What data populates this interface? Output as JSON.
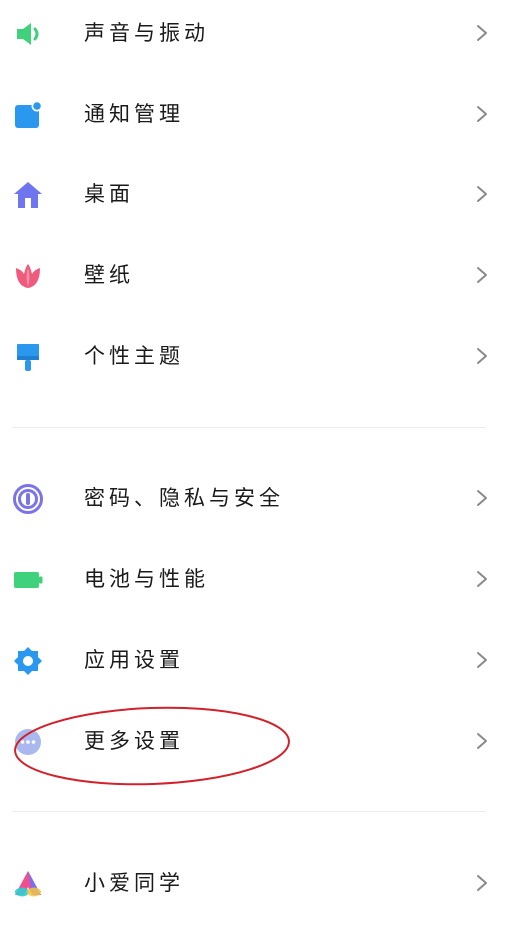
{
  "settings": {
    "group1": [
      {
        "label": "声音与振动",
        "icon": "speaker-icon"
      },
      {
        "label": "通知管理",
        "icon": "notification-icon"
      },
      {
        "label": "桌面",
        "icon": "home-icon"
      },
      {
        "label": "壁纸",
        "icon": "tulip-icon"
      },
      {
        "label": "个性主题",
        "icon": "paint-brush-icon"
      }
    ],
    "group2": [
      {
        "label": "密码、隐私与安全",
        "icon": "fingerprint-icon"
      },
      {
        "label": "电池与性能",
        "icon": "battery-icon"
      },
      {
        "label": "应用设置",
        "icon": "gear-icon"
      },
      {
        "label": "更多设置",
        "icon": "more-dots-icon"
      }
    ],
    "group3": [
      {
        "label": "小爱同学",
        "icon": "xiaoai-icon"
      }
    ]
  },
  "colors": {
    "sound": "#3fd17c",
    "notification": "#2b98f0",
    "home": "#6f74ef",
    "wallpaper": "#ef5a7d",
    "theme": "#2b98f0",
    "privacy": "#7b73e8",
    "battery": "#3fd17c",
    "app_settings": "#2b98f0",
    "more_settings": "#a9b8ee",
    "annotation": "#d2212b"
  }
}
